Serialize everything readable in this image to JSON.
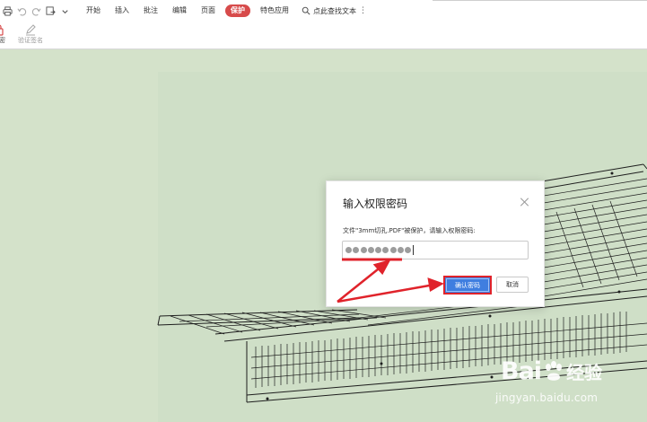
{
  "menu": {
    "items": [
      "开始",
      "插入",
      "批注",
      "编辑",
      "页面",
      "保护",
      "特色应用"
    ],
    "active_index": 5,
    "search_text": "点此查找文本",
    "more": "⋮"
  },
  "ribbon": {
    "encrypt_label": "加密",
    "verify_label": "验证签名"
  },
  "dialog": {
    "title": "输入权限密码",
    "message": "文件\"3mm切孔.PDF\"被保护，请输入权限密码:",
    "password_mask_count": 9,
    "confirm_label": "确认密码",
    "cancel_label": "取消"
  },
  "watermark": {
    "brand": "Bai",
    "brand_suffix": "经验",
    "url": "jingyan.baidu.com"
  },
  "colors": {
    "canvas_bg": "#d4e2ca",
    "page_bg": "#cfdfc7",
    "active_tab": "#d74b4b",
    "primary_button": "#3f7ee0",
    "annotation_red": "#e0232b"
  }
}
